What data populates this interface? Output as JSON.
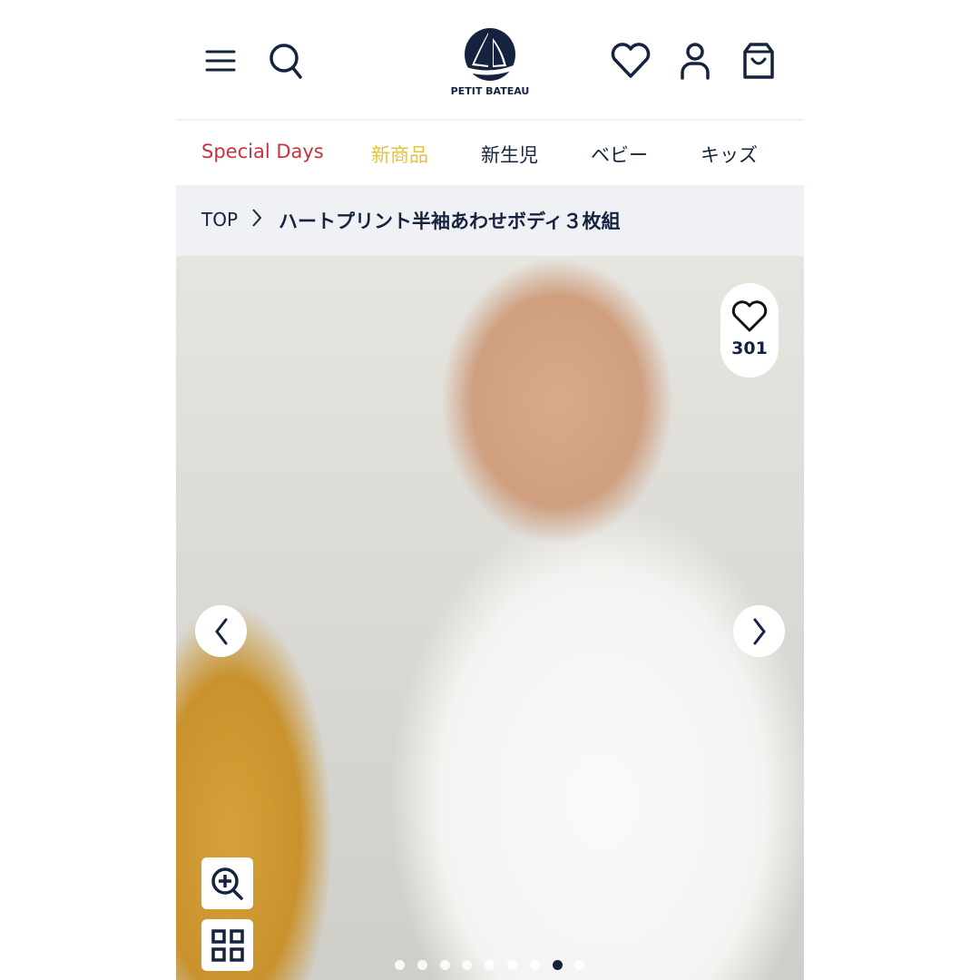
{
  "brand": {
    "name": "PETIT BATEAU",
    "primary_color": "#16233f"
  },
  "header": {
    "menu_icon": "hamburger-menu-icon",
    "search_icon": "search-icon",
    "wishlist_icon": "heart-icon",
    "account_icon": "user-icon",
    "cart_icon": "shopping-bag-icon"
  },
  "nav": {
    "items": [
      {
        "label": "Special Days",
        "color": "#c8323f"
      },
      {
        "label": "新商品",
        "color": "#e8c236"
      },
      {
        "label": "新生児",
        "color": "#16233f"
      },
      {
        "label": "ベビー",
        "color": "#16233f"
      },
      {
        "label": "キッズ",
        "color": "#16233f"
      }
    ]
  },
  "breadcrumb": {
    "home": "TOP",
    "separator_icon": "chevron-right-icon",
    "current": "ハートプリント半袖あわせボディ３枚組"
  },
  "gallery": {
    "favorite_count": "301",
    "favorite_icon": "heart-outline-icon",
    "prev_icon": "chevron-left-icon",
    "next_icon": "chevron-right-icon",
    "zoom_icon": "zoom-in-icon",
    "grid_icon": "grid-view-icon",
    "total_slides": 9,
    "active_slide": 8
  }
}
